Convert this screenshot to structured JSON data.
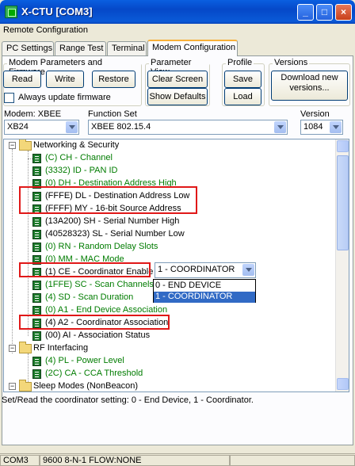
{
  "window": {
    "title": "X-CTU  [COM3]",
    "minimize_glyph": "_",
    "maximize_glyph": "□",
    "close_glyph": "×"
  },
  "header_label": "Remote Configuration",
  "tabs": [
    {
      "label": "PC Settings"
    },
    {
      "label": "Range Test"
    },
    {
      "label": "Terminal"
    },
    {
      "label": "Modem Configuration",
      "active": true
    }
  ],
  "groups": {
    "modem_params": {
      "label": "Modem Parameters and Firmware",
      "read": "Read",
      "write": "Write",
      "restore": "Restore",
      "always_update": "Always update firmware",
      "always_update_checked": false
    },
    "param_view": {
      "label": "Parameter View",
      "clear": "Clear Screen",
      "defaults": "Show Defaults"
    },
    "profile": {
      "label": "Profile",
      "save": "Save",
      "load": "Load"
    },
    "versions": {
      "label": "Versions",
      "download_line1": "Download new",
      "download_line2": "versions..."
    }
  },
  "selectors": {
    "modem_label": "Modem: XBEE",
    "modem_value": "XB24",
    "function_label": "Function Set",
    "function_value": "XBEE 802.15.4",
    "version_label": "Version",
    "version_value": "1084"
  },
  "tree": {
    "networking": {
      "label": "Networking & Security",
      "items": [
        "(C) CH - Channel",
        "(3332) ID - PAN ID",
        "(0) DH - Destination Address High",
        "(FFFE) DL - Destination Address Low",
        "(FFFF) MY - 16-bit Source Address",
        "(13A200) SH - Serial Number High",
        "(40528323) SL - Serial Number Low",
        "(0) RN - Random Delay Slots",
        "(0) MM - MAC Mode",
        "(1) CE - Coordinator Enable",
        "(1FFE) SC - Scan Channels",
        "(4) SD - Scan Duration",
        "(0) A1 - End Device Association",
        "(4) A2 - Coordinator Association",
        "(00) AI - Association Status"
      ]
    },
    "rf": {
      "label": "RF Interfacing",
      "items": [
        "(4) PL - Power Level",
        "(2C) CA - CCA Threshold"
      ]
    },
    "sleep": {
      "label": "Sleep Modes (NonBeacon)"
    }
  },
  "ce_dropdown": {
    "value": "1 - COORDINATOR",
    "options": [
      "0 - END DEVICE",
      "1 - COORDINATOR"
    ]
  },
  "description": "Set/Read the coordinator setting: 0 - End Device, 1 - Coordinator.",
  "status": {
    "port": "COM3",
    "settings": "9600 8-N-1  FLOW:NONE"
  },
  "colors": {
    "param_text": "#007c00",
    "highlight": "#e01818",
    "selection": "#316ac5"
  }
}
